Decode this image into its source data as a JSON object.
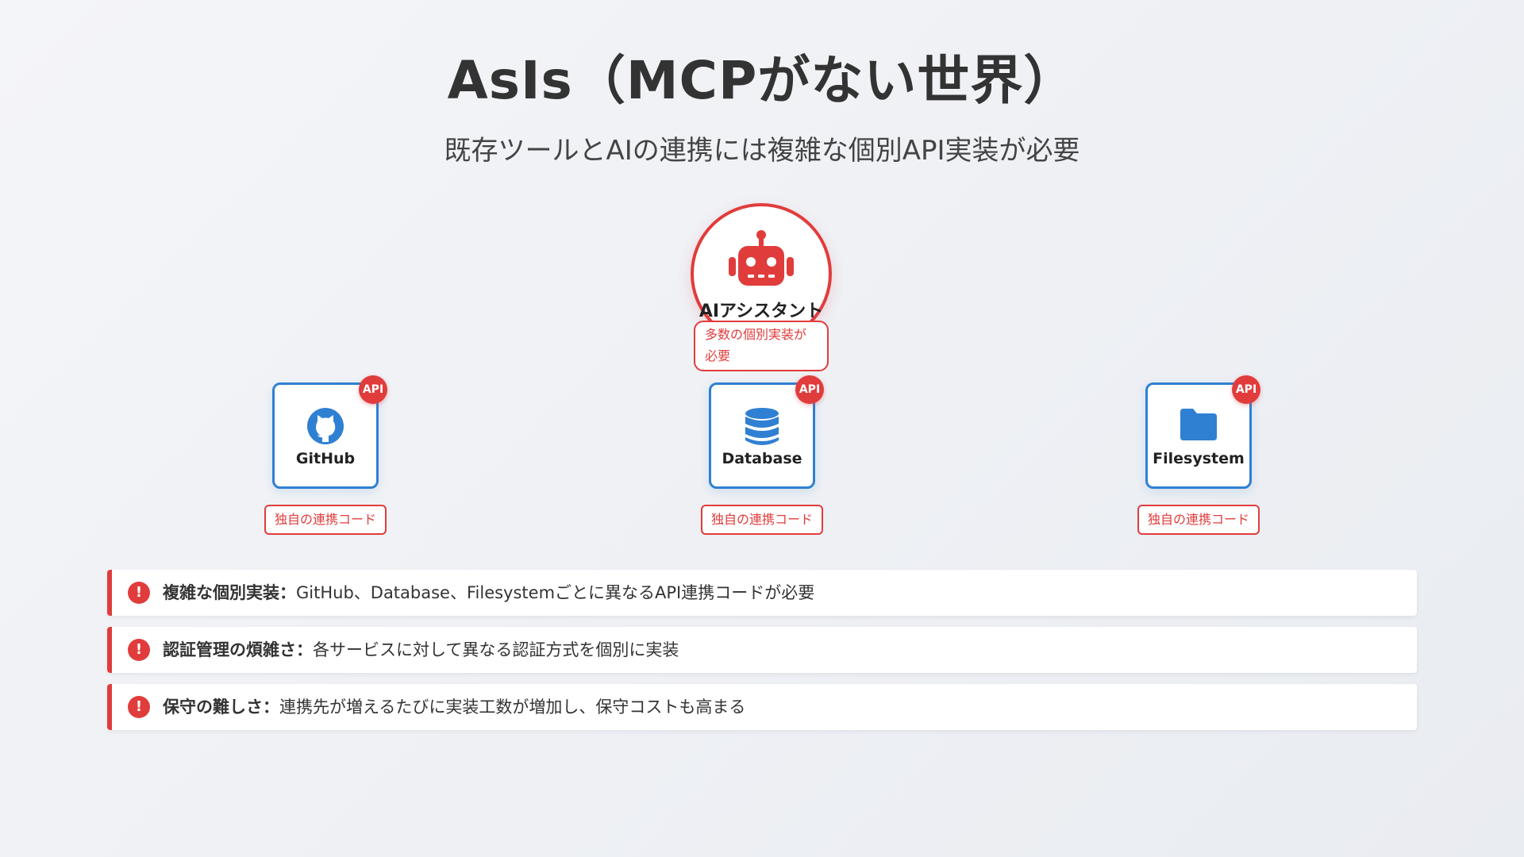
{
  "title": "AsIs（MCPがない世界）",
  "subtitle": "既存ツールとAIの連携には複雑な個別API実装が必要",
  "ai": {
    "label": "AIアシスタント",
    "note": "多数の個別実装が必要"
  },
  "tools": [
    {
      "label": "GitHub",
      "badge": "API",
      "note": "独自の連携コード",
      "icon": "github-icon"
    },
    {
      "label": "Database",
      "badge": "API",
      "note": "独自の連携コード",
      "icon": "database-icon"
    },
    {
      "label": "Filesystem",
      "badge": "API",
      "note": "独自の連携コード",
      "icon": "folder-icon"
    }
  ],
  "issues": [
    {
      "title": "複雑な個別実装：",
      "text": "GitHub、Database、Filesystemごとに異なるAPI連携コードが必要"
    },
    {
      "title": "認証管理の煩雑さ：",
      "text": "各サービスに対して異なる認証方式を個別に実装"
    },
    {
      "title": "保守の難しさ：",
      "text": "連携先が増えるたびに実装工数が増加し、保守コストも高まる"
    }
  ],
  "colors": {
    "accent_red": "#e13c3c",
    "accent_blue": "#2f80d2"
  },
  "issue_icon_glyph": "!"
}
